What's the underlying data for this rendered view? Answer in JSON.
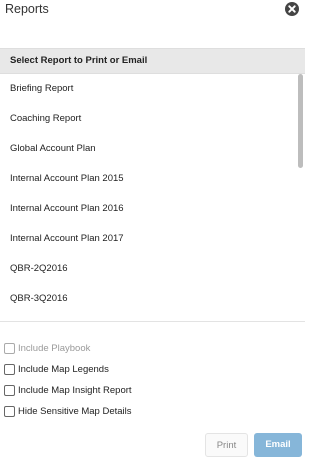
{
  "dialog": {
    "title": "Reports"
  },
  "header": {
    "label": "Select Report to Print or Email"
  },
  "reports": [
    "Briefing Report",
    "Coaching Report",
    "Global Account Plan",
    "Internal Account Plan 2015",
    "Internal Account Plan 2016",
    "Internal Account Plan 2017",
    "QBR-2Q2016",
    "QBR-3Q2016"
  ],
  "options": [
    {
      "label": "Include Playbook",
      "checked": false,
      "disabled": true
    },
    {
      "label": "Include Map Legends",
      "checked": false,
      "disabled": false
    },
    {
      "label": "Include Map Insight Report",
      "checked": false,
      "disabled": false
    },
    {
      "label": "Hide Sensitive Map Details",
      "checked": false,
      "disabled": false
    }
  ],
  "actions": {
    "print": "Print",
    "email": "Email"
  },
  "colors": {
    "accent": "#86b6d9",
    "header_bg": "#e8e8e8"
  },
  "icons": {
    "close": "close-circle-icon"
  }
}
